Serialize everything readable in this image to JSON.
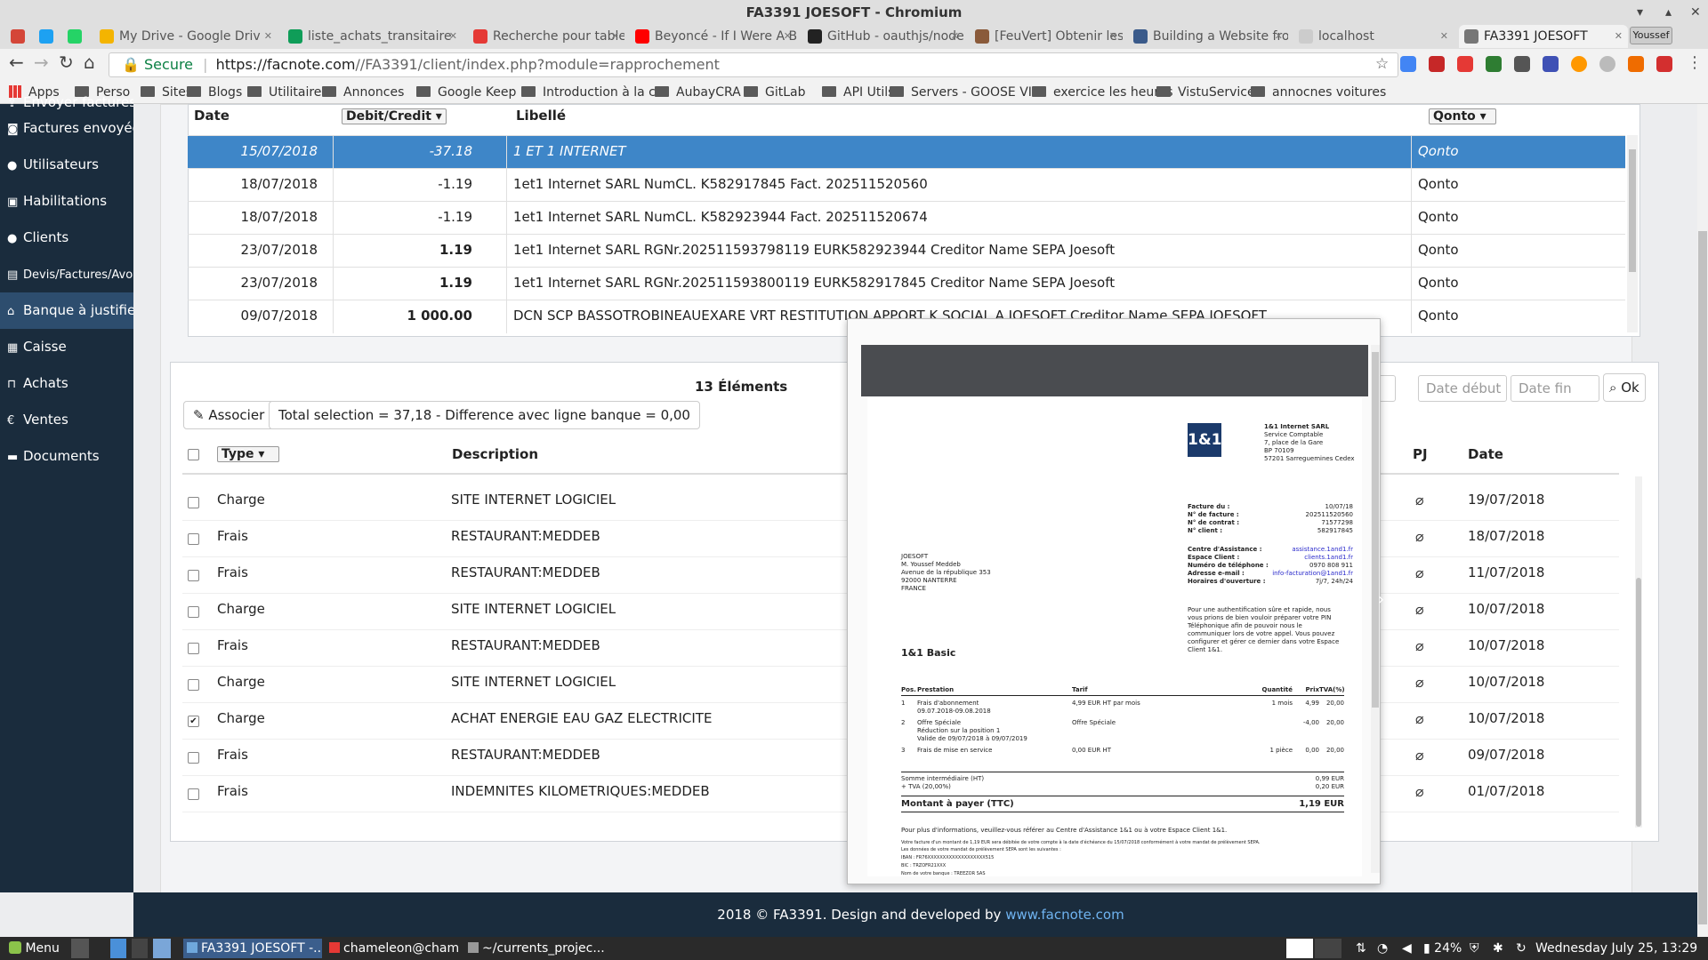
{
  "window": {
    "title": "FA3391 JOESOFT - Chromium",
    "user_badge": "Youssef"
  },
  "tabs": [
    {
      "label": "",
      "color": "#d44638"
    },
    {
      "label": "",
      "color": "#1da1f2"
    },
    {
      "label": "",
      "color": "#25d366"
    },
    {
      "label": "My Drive - Google Driv",
      "color": "#f4b400"
    },
    {
      "label": "liste_achats_transitaire",
      "color": "#0f9d58"
    },
    {
      "label": "Recherche pour tablea",
      "color": "#e53935"
    },
    {
      "label": "Beyoncé - If I Were A B",
      "color": "#ff0000"
    },
    {
      "label": "GitHub - oauthjs/node-",
      "color": "#222222"
    },
    {
      "label": "[FeuVert] Obtenir les in",
      "color": "#8a5a3a"
    },
    {
      "label": "Building a Website fron",
      "color": "#3a5a8a"
    },
    {
      "label": "localhost",
      "color": "#cccccc"
    },
    {
      "label": "FA3391 JOESOFT",
      "color": "#777777"
    }
  ],
  "address": {
    "secure_label": "Secure",
    "url_host": "https://facnote.com",
    "url_path": "//FA3391/client/index.php?module=rapprochement"
  },
  "bookmarks": [
    "Apps",
    "Perso",
    "Sites",
    "Blogs",
    "Utilitaires",
    "Annonces",
    "Google Keep",
    "Introduction à la co",
    "AubayCRA",
    "GitLab",
    "API Utils",
    "Servers - GOOSE VI",
    "exercice les heures",
    "VistuService",
    "annocnes voitures"
  ],
  "sidebar": [
    {
      "label": "Envoyer factures",
      "icon": "upload-icon"
    },
    {
      "label": "Factures envoyées",
      "icon": "camera-icon"
    },
    {
      "label": "Utilisateurs",
      "icon": "user-icon"
    },
    {
      "label": "Habilitations",
      "icon": "lock-icon"
    },
    {
      "label": "Clients",
      "icon": "users-icon"
    },
    {
      "label": "Devis/Factures/Avoir",
      "icon": "file-icon"
    },
    {
      "label": "Banque à justifier",
      "icon": "bank-icon"
    },
    {
      "label": "Caisse",
      "icon": "calculator-icon"
    },
    {
      "label": "Achats",
      "icon": "cart-icon"
    },
    {
      "label": "Ventes",
      "icon": "euro-icon"
    },
    {
      "label": "Documents",
      "icon": "folder-icon"
    }
  ],
  "bank": {
    "headers": {
      "date": "Date",
      "debit": "Debit/Credit",
      "libelle": "Libellé",
      "bank": "Qonto"
    },
    "rows": [
      {
        "date": "15/07/2018",
        "amount": "-37.18",
        "label": "1 ET 1 INTERNET",
        "bank": "Qonto",
        "selected": true
      },
      {
        "date": "18/07/2018",
        "amount": "-1.19",
        "label": "1et1 Internet SARL NumCL. K582917845 Fact. 202511520560",
        "bank": "Qonto"
      },
      {
        "date": "18/07/2018",
        "amount": "-1.19",
        "label": "1et1 Internet SARL NumCL. K582923944 Fact. 202511520674",
        "bank": "Qonto"
      },
      {
        "date": "23/07/2018",
        "amount": "1.19",
        "label": "1et1 Internet SARL RGNr.202511593798119 EURK582923944 Creditor Name SEPA Joesoft",
        "bank": "Qonto",
        "bold": true
      },
      {
        "date": "23/07/2018",
        "amount": "1.19",
        "label": "1et1 Internet SARL RGNr.202511593800119 EURK582917845 Creditor Name SEPA Joesoft",
        "bank": "Qonto",
        "bold": true
      },
      {
        "date": "09/07/2018",
        "amount": "1 000.00",
        "label": "DCN SCP BASSOTROBINEAUEXARE VRT RESTITUTION APPORT K SOCIAL A JOESOFT Creditor Name SEPA JOESOFT",
        "bank": "Qonto",
        "bold": true
      }
    ]
  },
  "docs": {
    "count_label": "13 Éléments",
    "associate_label": "Associer",
    "total_label": "Total selection = 37,18 - Difference avec ligne banque = 0,00",
    "date_start_placeholder": "Date début",
    "date_end_placeholder": "Date fin",
    "ok_label": "Ok",
    "headers": {
      "type": "Type",
      "description": "Description",
      "pj": "PJ",
      "date": "Date"
    },
    "rows": [
      {
        "type": "Charge",
        "desc": "SITE INTERNET LOGICIEL",
        "date": "19/07/2018",
        "checked": false
      },
      {
        "type": "Frais",
        "desc": "RESTAURANT:MEDDEB",
        "date": "18/07/2018",
        "checked": false
      },
      {
        "type": "Frais",
        "desc": "RESTAURANT:MEDDEB",
        "date": "11/07/2018",
        "checked": false
      },
      {
        "type": "Charge",
        "desc": "SITE INTERNET LOGICIEL",
        "date": "10/07/2018",
        "checked": false
      },
      {
        "type": "Frais",
        "desc": "RESTAURANT:MEDDEB",
        "date": "10/07/2018",
        "checked": false
      },
      {
        "type": "Charge",
        "desc": "SITE INTERNET LOGICIEL",
        "date": "10/07/2018",
        "checked": false
      },
      {
        "type": "Charge",
        "desc": "ACHAT ENERGIE EAU GAZ ELECTRICITE",
        "date": "10/07/2018",
        "checked": true
      },
      {
        "type": "Frais",
        "desc": "RESTAURANT:MEDDEB",
        "date": "09/07/2018",
        "checked": false
      },
      {
        "type": "Frais",
        "desc": "INDEMNITES KILOMETRIQUES:MEDDEB",
        "date": "01/07/2018",
        "checked": false
      }
    ]
  },
  "invoice": {
    "logo": "1&1",
    "company": [
      "1&1 Internet SARL",
      "Service Comptable",
      "7, place de la Gare",
      "BP 70109",
      "57201 Sarreguemines Cedex"
    ],
    "meta": [
      {
        "k": "Facture du :",
        "v": "10/07/18"
      },
      {
        "k": "N° de facture :",
        "v": "202511520560"
      },
      {
        "k": "N° de contrat :",
        "v": "71577298"
      },
      {
        "k": "N° client :",
        "v": "582917845"
      }
    ],
    "contact": [
      {
        "k": "Centre d'Assistance :",
        "v": "assistance.1and1.fr"
      },
      {
        "k": "Espace Client :",
        "v": "clients.1and1.fr"
      },
      {
        "k": "Numéro de téléphone :",
        "v": "0970 808 911"
      },
      {
        "k": "Adresse e-mail :",
        "v": "info-facturation@1and1.fr"
      },
      {
        "k": "Horaires d'ouverture :",
        "v": "7j/7, 24h/24"
      }
    ],
    "note": [
      "Pour une authentification sûre et rapide, nous",
      "vous prions de bien vouloir préparer votre PIN",
      "Téléphonique afin de pouvoir nous le",
      "communiquer lors de votre appel. Vous pouvez",
      "configurer et gérer ce dernier dans votre Espace",
      "Client 1&1."
    ],
    "address": [
      "JOESOFT",
      "M. Youssef Meddeb",
      "Avenue de la république 353",
      "92000 NANTERRE",
      "FRANCE"
    ],
    "product": "1&1 Basic",
    "cols": [
      "Pos.",
      "Prestation",
      "Tarif",
      "Quantité",
      "Prix",
      "TVA(%)"
    ],
    "lines": [
      {
        "pos": "1",
        "desc": "Frais d'abonnement",
        "tarif": "4,99 EUR HT par mois",
        "qty": "1 mois",
        "price": "4,99",
        "tva": "20,00",
        "sub": [
          "09.07.2018-09.08.2018"
        ]
      },
      {
        "pos": "2",
        "desc": "Offre Spéciale",
        "tarif": "Offre Spéciale",
        "qty": "",
        "price": "-4,00",
        "tva": "20,00",
        "sub": [
          "Réduction sur la position 1",
          "Valide de 09/07/2018 à 09/07/2019"
        ]
      },
      {
        "pos": "3",
        "desc": "Frais de mise en service",
        "tarif": "0,00 EUR HT",
        "qty": "1 pièce",
        "price": "0,00",
        "tva": "20,00",
        "sub": []
      }
    ],
    "subtotal_label": "Somme intermédiaire (HT)",
    "subtotal": "0,99 EUR",
    "tva_label": "+ TVA (20,00%)",
    "tva": "0,20 EUR",
    "total_label": "Montant à payer (TTC)",
    "total": "1,19 EUR",
    "footer1": "Pour plus d'informations, veuillez-vous référer au Centre d'Assistance 1&1 ou à votre Espace Client 1&1.",
    "footer2": "Votre facture d'un montant de 1,19 EUR sera débitée de votre compte à la date d'échéance du 15/07/2018 conformément à votre mandat de prélèvement SEPA.",
    "footer3": [
      "Les données de votre mandat de prélèvement SEPA sont les suivantes :",
      "IBAN : FR76XXXXXXXXXXXXXXXXXXX515",
      "BIC : TRZOFR21XXX",
      "Nom de votre banque : TREEZOR SAS",
      "Référence du mandat : 00000011ZJHR9"
    ]
  },
  "footer": {
    "text": "2018 © FA3391. Design and developed by ",
    "link": "www.facnote.com"
  },
  "taskbar": {
    "menu": "Menu",
    "items": [
      "FA3391 JOESOFT -...",
      "chameleon@cham...",
      "~/currents_projec..."
    ],
    "battery": "24%",
    "clock": "Wednesday July 25, 13:29"
  }
}
